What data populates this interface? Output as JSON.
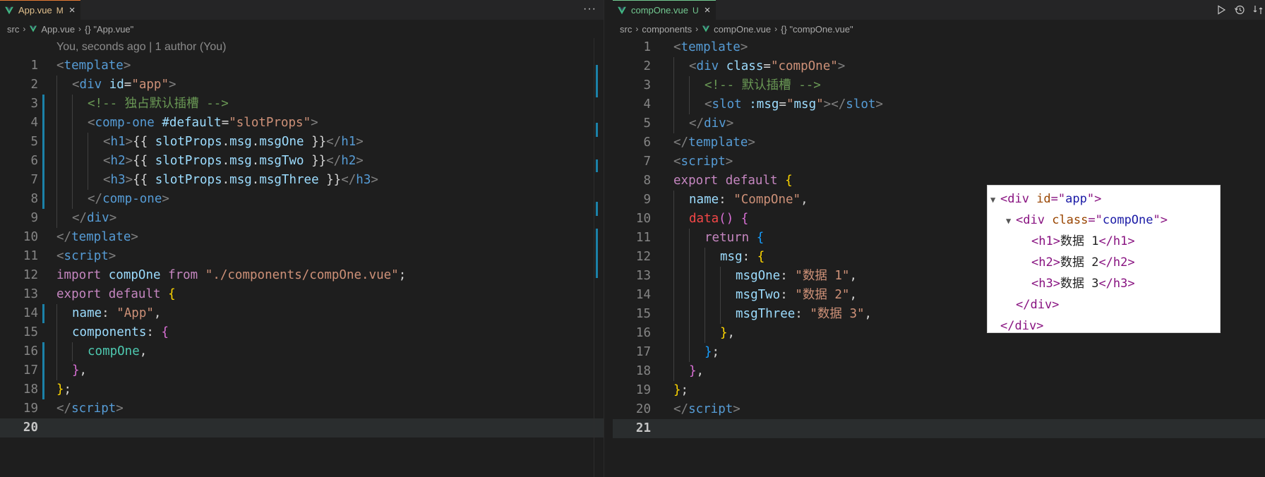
{
  "left": {
    "tab": {
      "title": "App.vue",
      "badge": "M",
      "close": "×"
    },
    "more": "···",
    "breadcrumb": {
      "folder": "src",
      "file": "App.vue",
      "symbol": "{} \"App.vue\""
    },
    "codelens": "You, seconds ago | 1 author (You)",
    "current_line": 20,
    "lines": [
      {
        "n": "1",
        "indent": 0,
        "mark": false,
        "tokens": [
          [
            "t-br",
            "<"
          ],
          [
            "t-tag",
            "template"
          ],
          [
            "t-br",
            ">"
          ]
        ]
      },
      {
        "n": "2",
        "indent": 1,
        "mark": false,
        "tokens": [
          [
            "t-br",
            "<"
          ],
          [
            "t-tag",
            "div"
          ],
          [
            "t-txt",
            " "
          ],
          [
            "t-attr",
            "id"
          ],
          [
            "t-txt",
            "="
          ],
          [
            "t-str",
            "\"app\""
          ],
          [
            "t-br",
            ">"
          ]
        ]
      },
      {
        "n": "3",
        "indent": 2,
        "mark": true,
        "tokens": [
          [
            "t-com",
            "<!-- 独占默认插槽 -->"
          ]
        ]
      },
      {
        "n": "4",
        "indent": 2,
        "mark": true,
        "tokens": [
          [
            "t-br",
            "<"
          ],
          [
            "t-tag",
            "comp-one"
          ],
          [
            "t-txt",
            " "
          ],
          [
            "t-attr",
            "#default"
          ],
          [
            "t-txt",
            "="
          ],
          [
            "t-str",
            "\"slotProps\""
          ],
          [
            "t-br",
            ">"
          ]
        ]
      },
      {
        "n": "5",
        "indent": 3,
        "mark": true,
        "tokens": [
          [
            "t-br",
            "<"
          ],
          [
            "t-tag",
            "h1"
          ],
          [
            "t-br",
            ">"
          ],
          [
            "t-txt",
            "{{ "
          ],
          [
            "t-var",
            "slotProps"
          ],
          [
            "t-txt",
            "."
          ],
          [
            "t-var",
            "msg"
          ],
          [
            "t-txt",
            "."
          ],
          [
            "t-var",
            "msgOne"
          ],
          [
            "t-txt",
            " }}"
          ],
          [
            "t-br",
            "</"
          ],
          [
            "t-tag",
            "h1"
          ],
          [
            "t-br",
            ">"
          ]
        ]
      },
      {
        "n": "6",
        "indent": 3,
        "mark": true,
        "tokens": [
          [
            "t-br",
            "<"
          ],
          [
            "t-tag",
            "h2"
          ],
          [
            "t-br",
            ">"
          ],
          [
            "t-txt",
            "{{ "
          ],
          [
            "t-var",
            "slotProps"
          ],
          [
            "t-txt",
            "."
          ],
          [
            "t-var",
            "msg"
          ],
          [
            "t-txt",
            "."
          ],
          [
            "t-var",
            "msgTwo"
          ],
          [
            "t-txt",
            " }}"
          ],
          [
            "t-br",
            "</"
          ],
          [
            "t-tag",
            "h2"
          ],
          [
            "t-br",
            ">"
          ]
        ]
      },
      {
        "n": "7",
        "indent": 3,
        "mark": true,
        "tokens": [
          [
            "t-br",
            "<"
          ],
          [
            "t-tag",
            "h3"
          ],
          [
            "t-br",
            ">"
          ],
          [
            "t-txt",
            "{{ "
          ],
          [
            "t-var",
            "slotProps"
          ],
          [
            "t-txt",
            "."
          ],
          [
            "t-var",
            "msg"
          ],
          [
            "t-txt",
            "."
          ],
          [
            "t-var",
            "msgThree"
          ],
          [
            "t-txt",
            " }}"
          ],
          [
            "t-br",
            "</"
          ],
          [
            "t-tag",
            "h3"
          ],
          [
            "t-br",
            ">"
          ]
        ]
      },
      {
        "n": "8",
        "indent": 2,
        "mark": true,
        "tokens": [
          [
            "t-br",
            "</"
          ],
          [
            "t-tag",
            "comp-one"
          ],
          [
            "t-br",
            ">"
          ]
        ]
      },
      {
        "n": "9",
        "indent": 1,
        "mark": false,
        "tokens": [
          [
            "t-br",
            "</"
          ],
          [
            "t-tag",
            "div"
          ],
          [
            "t-br",
            ">"
          ]
        ]
      },
      {
        "n": "10",
        "indent": 0,
        "mark": false,
        "tokens": [
          [
            "t-br",
            "</"
          ],
          [
            "t-tag",
            "template"
          ],
          [
            "t-br",
            ">"
          ]
        ]
      },
      {
        "n": "11",
        "indent": 0,
        "mark": false,
        "tokens": [
          [
            "t-br",
            "<"
          ],
          [
            "t-tag",
            "script"
          ],
          [
            "t-br",
            ">"
          ]
        ]
      },
      {
        "n": "12",
        "indent": 0,
        "mark": false,
        "tokens": [
          [
            "t-kw",
            "import"
          ],
          [
            "t-txt",
            " "
          ],
          [
            "t-var",
            "compOne"
          ],
          [
            "t-txt",
            " "
          ],
          [
            "t-kw",
            "from"
          ],
          [
            "t-txt",
            " "
          ],
          [
            "t-str",
            "\"./components/compOne.vue\""
          ],
          [
            "t-txt",
            ";"
          ]
        ]
      },
      {
        "n": "13",
        "indent": 0,
        "mark": false,
        "tokens": [
          [
            "t-kw",
            "export"
          ],
          [
            "t-txt",
            " "
          ],
          [
            "t-kw",
            "default"
          ],
          [
            "t-txt",
            " "
          ],
          [
            "t-brace1",
            "{"
          ]
        ]
      },
      {
        "n": "14",
        "indent": 1,
        "mark": true,
        "tokens": [
          [
            "t-prop",
            "name"
          ],
          [
            "t-txt",
            ": "
          ],
          [
            "t-str",
            "\"App\""
          ],
          [
            "t-txt",
            ","
          ]
        ]
      },
      {
        "n": "15",
        "indent": 1,
        "mark": false,
        "tokens": [
          [
            "t-prop",
            "components"
          ],
          [
            "t-txt",
            ": "
          ],
          [
            "t-brace2",
            "{"
          ]
        ]
      },
      {
        "n": "16",
        "indent": 2,
        "mark": true,
        "tokens": [
          [
            "t-comp",
            "compOne"
          ],
          [
            "t-txt",
            ","
          ]
        ]
      },
      {
        "n": "17",
        "indent": 1,
        "mark": true,
        "tokens": [
          [
            "t-brace2",
            "}"
          ],
          [
            "t-txt",
            ","
          ]
        ]
      },
      {
        "n": "18",
        "indent": 0,
        "mark": true,
        "tokens": [
          [
            "t-brace1",
            "}"
          ],
          [
            "t-txt",
            ";"
          ]
        ]
      },
      {
        "n": "19",
        "indent": 0,
        "mark": false,
        "tokens": [
          [
            "t-br",
            "</"
          ],
          [
            "t-tag",
            "script"
          ],
          [
            "t-br",
            ">"
          ]
        ]
      },
      {
        "n": "20",
        "indent": 0,
        "mark": false,
        "tokens": []
      }
    ]
  },
  "right": {
    "tab": {
      "title": "compOne.vue",
      "badge": "U",
      "close": "×"
    },
    "breadcrumb": {
      "folder": "src",
      "sub": "components",
      "file": "compOne.vue",
      "symbol": "{} \"compOne.vue\""
    },
    "current_line": 21,
    "lines": [
      {
        "n": "1",
        "indent": 0,
        "tokens": [
          [
            "t-br",
            "<"
          ],
          [
            "t-tag",
            "template"
          ],
          [
            "t-br",
            ">"
          ]
        ]
      },
      {
        "n": "2",
        "indent": 1,
        "tokens": [
          [
            "t-br",
            "<"
          ],
          [
            "t-tag",
            "div"
          ],
          [
            "t-txt",
            " "
          ],
          [
            "t-attr",
            "class"
          ],
          [
            "t-txt",
            "="
          ],
          [
            "t-str",
            "\"compOne\""
          ],
          [
            "t-br",
            ">"
          ]
        ]
      },
      {
        "n": "3",
        "indent": 2,
        "tokens": [
          [
            "t-com",
            "<!-- 默认插槽 -->"
          ]
        ]
      },
      {
        "n": "4",
        "indent": 2,
        "tokens": [
          [
            "t-br",
            "<"
          ],
          [
            "t-tag",
            "slot"
          ],
          [
            "t-txt",
            " "
          ],
          [
            "t-attr",
            ":msg"
          ],
          [
            "t-txt",
            "="
          ],
          [
            "t-str",
            "\""
          ],
          [
            "t-var",
            "msg"
          ],
          [
            "t-str",
            "\""
          ],
          [
            "t-br",
            "></"
          ],
          [
            "t-tag",
            "slot"
          ],
          [
            "t-br",
            ">"
          ]
        ]
      },
      {
        "n": "5",
        "indent": 1,
        "tokens": [
          [
            "t-br",
            "</"
          ],
          [
            "t-tag",
            "div"
          ],
          [
            "t-br",
            ">"
          ]
        ]
      },
      {
        "n": "6",
        "indent": 0,
        "tokens": [
          [
            "t-br",
            "</"
          ],
          [
            "t-tag",
            "template"
          ],
          [
            "t-br",
            ">"
          ]
        ]
      },
      {
        "n": "7",
        "indent": 0,
        "tokens": [
          [
            "t-br",
            "<"
          ],
          [
            "t-tag",
            "script"
          ],
          [
            "t-br",
            ">"
          ]
        ]
      },
      {
        "n": "8",
        "indent": 0,
        "tokens": [
          [
            "t-kw",
            "export"
          ],
          [
            "t-txt",
            " "
          ],
          [
            "t-kw",
            "default"
          ],
          [
            "t-txt",
            " "
          ],
          [
            "t-brace1",
            "{"
          ]
        ]
      },
      {
        "n": "9",
        "indent": 1,
        "tokens": [
          [
            "t-prop",
            "name"
          ],
          [
            "t-txt",
            ": "
          ],
          [
            "t-str",
            "\"CompOne\""
          ],
          [
            "t-txt",
            ","
          ]
        ]
      },
      {
        "n": "10",
        "indent": 1,
        "tokens": [
          [
            "t-red",
            "data"
          ],
          [
            "t-brace2",
            "()"
          ],
          [
            "t-txt",
            " "
          ],
          [
            "t-brace2",
            "{"
          ]
        ]
      },
      {
        "n": "11",
        "indent": 2,
        "tokens": [
          [
            "t-kw",
            "return"
          ],
          [
            "t-txt",
            " "
          ],
          [
            "t-brace3",
            "{"
          ]
        ]
      },
      {
        "n": "12",
        "indent": 3,
        "tokens": [
          [
            "t-prop",
            "msg"
          ],
          [
            "t-txt",
            ": "
          ],
          [
            "t-brace1",
            "{"
          ]
        ]
      },
      {
        "n": "13",
        "indent": 4,
        "tokens": [
          [
            "t-prop",
            "msgOne"
          ],
          [
            "t-txt",
            ": "
          ],
          [
            "t-str",
            "\"数据 1\""
          ],
          [
            "t-txt",
            ","
          ]
        ]
      },
      {
        "n": "14",
        "indent": 4,
        "tokens": [
          [
            "t-prop",
            "msgTwo"
          ],
          [
            "t-txt",
            ": "
          ],
          [
            "t-str",
            "\"数据 2\""
          ],
          [
            "t-txt",
            ","
          ]
        ]
      },
      {
        "n": "15",
        "indent": 4,
        "tokens": [
          [
            "t-prop",
            "msgThree"
          ],
          [
            "t-txt",
            ": "
          ],
          [
            "t-str",
            "\"数据 3\""
          ],
          [
            "t-txt",
            ","
          ]
        ]
      },
      {
        "n": "16",
        "indent": 3,
        "tokens": [
          [
            "t-brace1",
            "}"
          ],
          [
            "t-txt",
            ","
          ]
        ]
      },
      {
        "n": "17",
        "indent": 2,
        "tokens": [
          [
            "t-brace3",
            "}"
          ],
          [
            "t-txt",
            ";"
          ]
        ]
      },
      {
        "n": "18",
        "indent": 1,
        "tokens": [
          [
            "t-brace2",
            "}"
          ],
          [
            "t-txt",
            ","
          ]
        ]
      },
      {
        "n": "19",
        "indent": 0,
        "tokens": [
          [
            "t-brace1",
            "}"
          ],
          [
            "t-txt",
            ";"
          ]
        ]
      },
      {
        "n": "20",
        "indent": 0,
        "tokens": [
          [
            "t-br",
            "</"
          ],
          [
            "t-tag",
            "script"
          ],
          [
            "t-br",
            ">"
          ]
        ]
      },
      {
        "n": "21",
        "indent": 0,
        "tokens": []
      }
    ]
  },
  "devtools": {
    "rows": [
      {
        "indent": 0,
        "tri": "▼",
        "tokens": [
          [
            "dt-tag",
            "<div "
          ],
          [
            "dt-attr",
            "id"
          ],
          [
            "dt-tag",
            "=\""
          ],
          [
            "dt-val",
            "app"
          ],
          [
            "dt-tag",
            "\">"
          ]
        ]
      },
      {
        "indent": 1,
        "tri": "▼",
        "tokens": [
          [
            "dt-tag",
            "<div "
          ],
          [
            "dt-attr",
            "class"
          ],
          [
            "dt-tag",
            "=\""
          ],
          [
            "dt-val",
            "compOne"
          ],
          [
            "dt-tag",
            "\">"
          ]
        ]
      },
      {
        "indent": 2,
        "tri": "",
        "tokens": [
          [
            "dt-tag",
            "<h1>"
          ],
          [
            "dt-txt",
            "数据 1"
          ],
          [
            "dt-tag",
            "</h1>"
          ]
        ]
      },
      {
        "indent": 2,
        "tri": "",
        "tokens": [
          [
            "dt-tag",
            "<h2>"
          ],
          [
            "dt-txt",
            "数据 2"
          ],
          [
            "dt-tag",
            "</h2>"
          ]
        ]
      },
      {
        "indent": 2,
        "tri": "",
        "tokens": [
          [
            "dt-tag",
            "<h3>"
          ],
          [
            "dt-txt",
            "数据 3"
          ],
          [
            "dt-tag",
            "</h3>"
          ]
        ]
      },
      {
        "indent": 1,
        "tri": "",
        "tokens": [
          [
            "dt-tag",
            "</div>"
          ]
        ]
      },
      {
        "indent": 0,
        "tri": "",
        "tokens": [
          [
            "dt-tag",
            "</div>"
          ]
        ]
      }
    ]
  },
  "colors": {
    "accent_blue": "#1b81a8",
    "modified": "#e2c08d",
    "untracked": "#73c991",
    "vue_green": "#41b883"
  },
  "icons": {
    "vue": "vue-logo-icon",
    "run": "play-icon",
    "timeline": "history-icon",
    "compare": "compare-icon"
  }
}
